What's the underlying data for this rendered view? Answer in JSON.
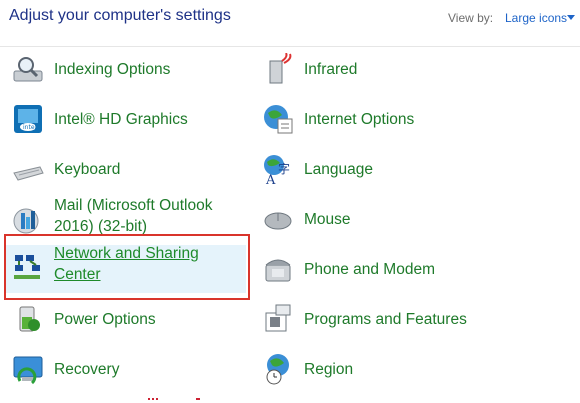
{
  "header": {
    "title": "Adjust your computer's settings",
    "view_by_label": "View by:",
    "view_by_value": "Large icons"
  },
  "items": {
    "indexing": "Indexing Options",
    "infrared": "Infrared",
    "intel_hd": "Intel® HD Graphics",
    "internet_options": "Internet Options",
    "keyboard": "Keyboard",
    "language": "Language",
    "mail_line1": "Mail (Microsoft Outlook",
    "mail_line2": "2016) (32-bit)",
    "mouse": "Mouse",
    "network_line1": "Network and Sharing",
    "network_line2": "Center",
    "phone_modem": "Phone and Modem",
    "power": "Power Options",
    "programs": "Programs and Features",
    "recovery": "Recovery",
    "region": "Region"
  },
  "colors": {
    "link_green": "#1e7a2a",
    "title_blue": "#1e3287",
    "selection_bg": "#e5f3fb",
    "highlight_red": "#d9342b"
  }
}
